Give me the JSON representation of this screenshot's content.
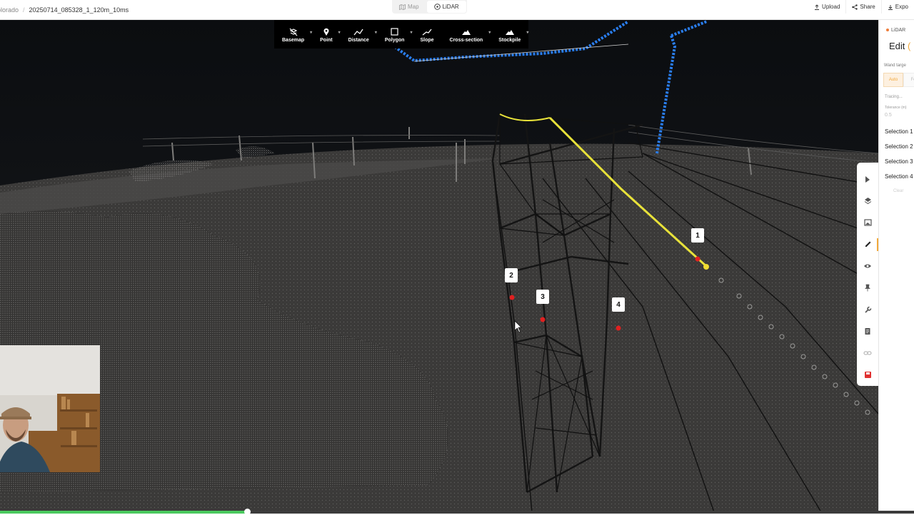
{
  "header": {
    "breadcrumb_parent": "olorado",
    "breadcrumb_separator": "/",
    "file_name": "20250714_085328_1_120m_10ms",
    "view_toggle": [
      {
        "label": "Map",
        "icon": "map-icon",
        "active": false
      },
      {
        "label": "LiDAR",
        "icon": "lidar-icon",
        "active": true
      }
    ],
    "actions": [
      {
        "label": "Upload",
        "icon": "upload-icon"
      },
      {
        "label": "Share",
        "icon": "share-icon"
      },
      {
        "label": "Expo",
        "icon": "download-icon"
      }
    ]
  },
  "measure_toolbar": [
    {
      "label": "Basemap",
      "icon": "basemap-off-icon"
    },
    {
      "label": "Point",
      "icon": "pin-icon"
    },
    {
      "label": "Distance",
      "icon": "distance-icon"
    },
    {
      "label": "Polygon",
      "icon": "polygon-icon"
    },
    {
      "label": "Slope",
      "icon": "slope-icon"
    },
    {
      "label": "Cross-section",
      "icon": "cross-section-icon"
    },
    {
      "label": "Stockpile",
      "icon": "stockpile-icon"
    }
  ],
  "markers": [
    {
      "label": "1"
    },
    {
      "label": "2"
    },
    {
      "label": "3"
    },
    {
      "label": "4"
    }
  ],
  "vertical_toolbar": [
    {
      "icon": "cursor-icon"
    },
    {
      "icon": "layers-icon"
    },
    {
      "icon": "image-icon"
    },
    {
      "icon": "pencil-icon",
      "active": true
    },
    {
      "icon": "eye-icon"
    },
    {
      "icon": "pin-icon"
    },
    {
      "icon": "wrench-icon"
    },
    {
      "icon": "document-icon"
    },
    {
      "icon": "link-icon"
    },
    {
      "icon": "save-icon"
    }
  ],
  "side_panel": {
    "badge": "LiDAR",
    "title": "Edit",
    "title_accent": "(",
    "wand_label": "Wand targe",
    "segment_on": "Auto",
    "segment_off": "Fo",
    "tracing_label": "Tracing...",
    "tolerance_label": "Tolerance (m)",
    "tolerance_value": "0.5",
    "selections": [
      "Selection 1",
      "Selection 2",
      "Selection 3",
      "Selection 4"
    ],
    "clear_label": "Clear"
  },
  "colors": {
    "accent": "#f2a93b",
    "selection_line": "#e8e23a",
    "marker_point": "#e02020",
    "powerline_blue": "#2a7ef0",
    "playback": "#4ac95e"
  },
  "video_progress": 0.27
}
